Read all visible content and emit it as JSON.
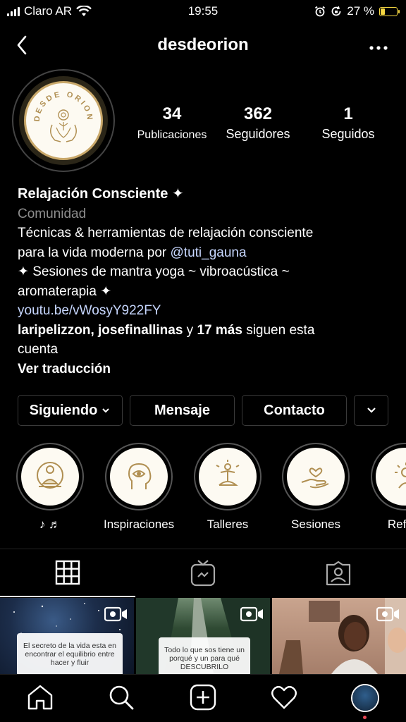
{
  "status_bar": {
    "carrier": "Claro AR",
    "time": "19:55",
    "battery_percent": "27 %",
    "battery_level": 0.27,
    "accent": "#f5d742"
  },
  "header": {
    "username": "desdeorion",
    "back_icon": "chevron-left-icon",
    "more_icon": "more-dots-icon"
  },
  "profile": {
    "avatar_text": "DESDE ORION",
    "stats": [
      {
        "value": "34",
        "label": "Publicaciones"
      },
      {
        "value": "362",
        "label": "Seguidores"
      },
      {
        "value": "1",
        "label": "Seguidos"
      }
    ]
  },
  "bio": {
    "name": "Relajación Consciente ✦",
    "category": "Comunidad",
    "line1": "Técnicas & herramientas de relajación consciente",
    "line2_prefix": "para la vida moderna por ",
    "mention": "@tuti_gauna",
    "line3": "✦ Sesiones de mantra yoga ~ vibroacústica ~",
    "line4": "aromaterapia ✦",
    "link": "youtu.be/vWosyY922FY",
    "followed_by_users": "laripelizzon, josefinallinas",
    "followed_by_and": " y ",
    "followed_by_count": "17 más",
    "followed_by_suffix": " siguen esta",
    "followed_by_suffix2": "cuenta",
    "translate": "Ver traducción"
  },
  "actions": {
    "following_label": "Siguiendo",
    "message_label": "Mensaje",
    "contact_label": "Contacto"
  },
  "highlights": [
    {
      "label": "♪ ♬",
      "icon": "meditation-icon"
    },
    {
      "label": "Inspiraciones",
      "icon": "mind-eye-icon"
    },
    {
      "label": "Talleres",
      "icon": "yoga-pose-icon"
    },
    {
      "label": "Sesiones",
      "icon": "heart-hand-icon"
    },
    {
      "label": "Reflex",
      "icon": "sun-person-icon"
    }
  ],
  "tabs": [
    {
      "icon": "grid-icon",
      "active": true
    },
    {
      "icon": "igtv-icon",
      "active": false
    },
    {
      "icon": "tagged-icon",
      "active": false
    }
  ],
  "posts": [
    {
      "text": "El secreto de la vida esta en encontrar el equilibrio entre hacer y fluir",
      "icon": "video-icon"
    },
    {
      "text": "Todo lo que sos tiene un porqué y un para qué DESCUBRILO",
      "icon": "video-icon"
    },
    {
      "text": "",
      "icon": "video-icon"
    }
  ],
  "bottom_nav": [
    {
      "icon": "home-icon"
    },
    {
      "icon": "search-icon"
    },
    {
      "icon": "add-post-icon"
    },
    {
      "icon": "heart-icon"
    },
    {
      "icon": "profile-avatar-icon"
    }
  ]
}
